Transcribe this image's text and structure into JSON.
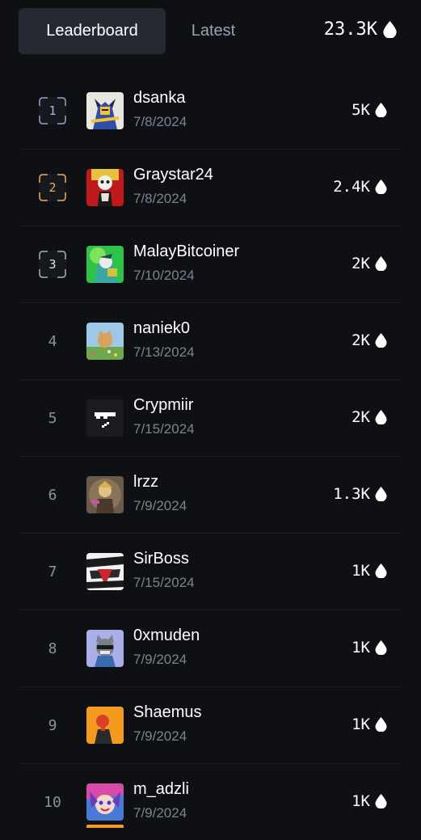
{
  "tabs": {
    "leaderboard": "Leaderboard",
    "latest": "Latest"
  },
  "total": "23.3K",
  "colors": {
    "background": "#0f1014",
    "active_tab": "#252932",
    "rank1_bracket": "#8fa3c8",
    "rank2_bracket": "#e3b25a",
    "rank3_bracket": "#aab1bd",
    "muted_text": "#7b8290"
  },
  "icons": {
    "score": "droplet-icon"
  },
  "rows": [
    {
      "rank": "1",
      "name": "dsanka",
      "date": "7/8/2024",
      "score": "5K"
    },
    {
      "rank": "2",
      "name": "Graystar24",
      "date": "7/8/2024",
      "score": "2.4K"
    },
    {
      "rank": "3",
      "name": "MalayBitcoiner",
      "date": "7/10/2024",
      "score": "2K"
    },
    {
      "rank": "4",
      "name": "naniek0",
      "date": "7/13/2024",
      "score": "2K"
    },
    {
      "rank": "5",
      "name": "Crypmiir",
      "date": "7/15/2024",
      "score": "2K"
    },
    {
      "rank": "6",
      "name": "lrzz",
      "date": "7/9/2024",
      "score": "1.3K"
    },
    {
      "rank": "7",
      "name": "SirBoss",
      "date": "7/15/2024",
      "score": "1K"
    },
    {
      "rank": "8",
      "name": "0xmuden",
      "date": "7/9/2024",
      "score": "1K"
    },
    {
      "rank": "9",
      "name": "Shaemus",
      "date": "7/9/2024",
      "score": "1K"
    },
    {
      "rank": "10",
      "name": "m_adzli",
      "date": "7/9/2024",
      "score": "1K"
    }
  ]
}
